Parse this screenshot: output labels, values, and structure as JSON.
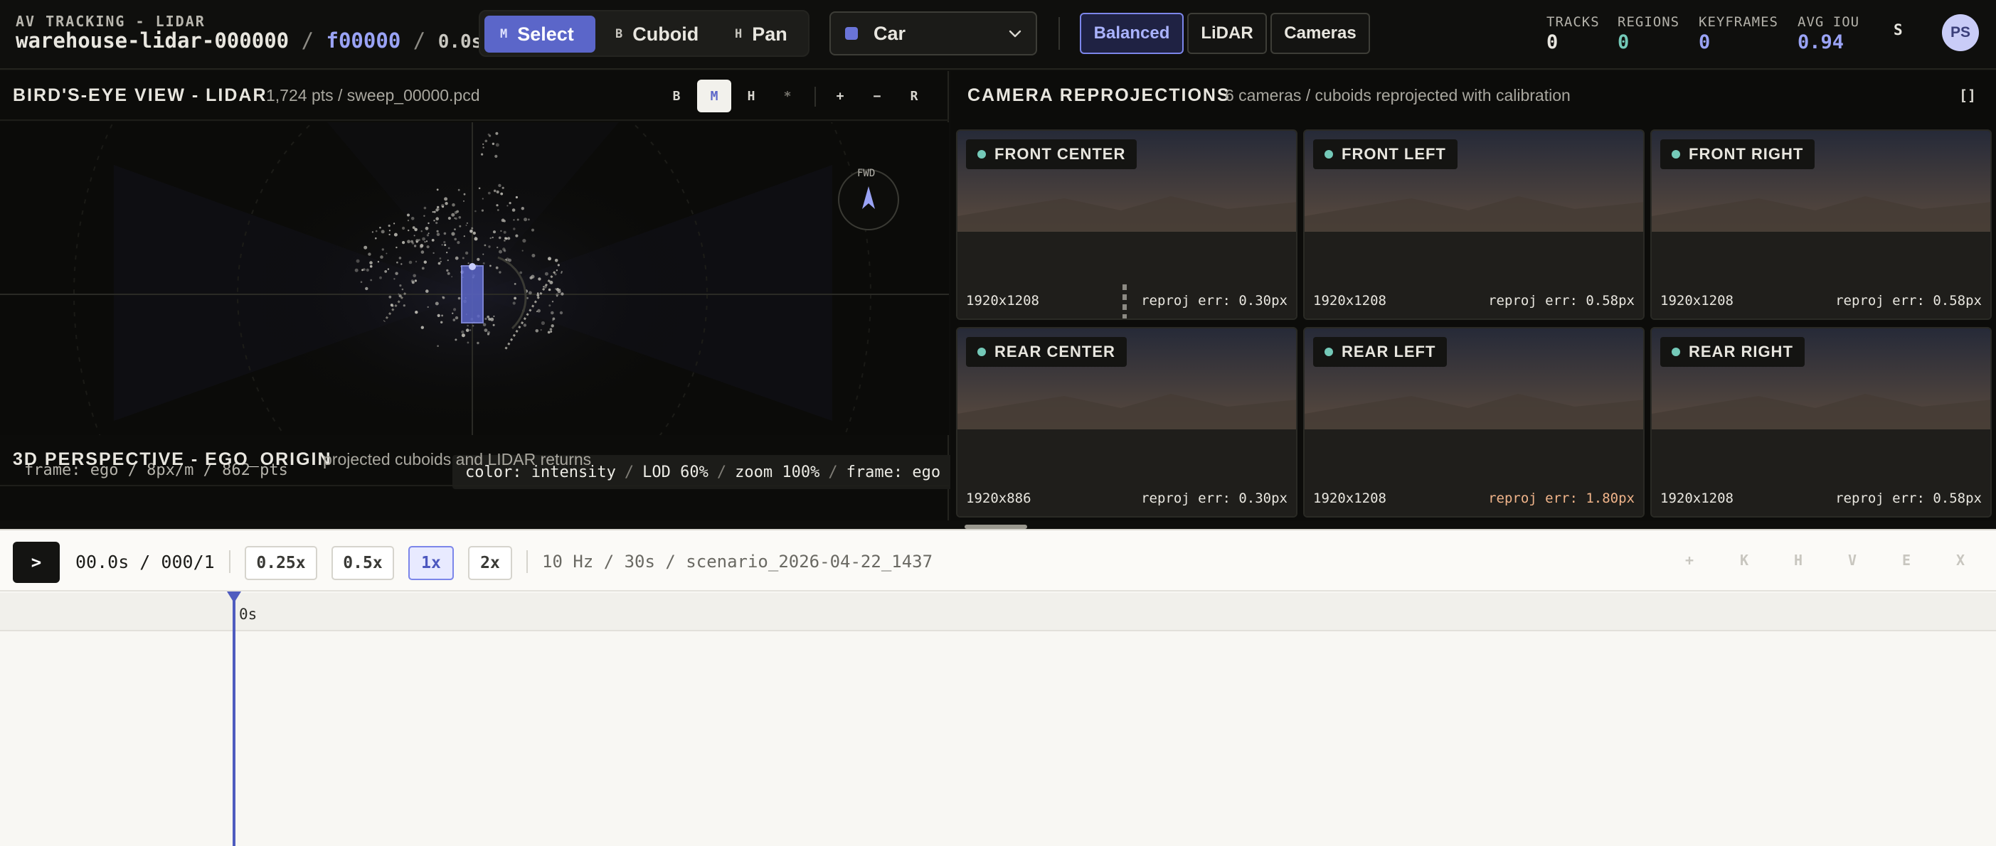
{
  "header": {
    "kicker": "AV TRACKING - LIDAR",
    "dataset": "warehouse-lidar-000000",
    "sep1": "/",
    "frame": "f00000",
    "sep2": "/",
    "time": "0.0s",
    "tools": [
      {
        "key": "M",
        "label": "Select",
        "active": true
      },
      {
        "key": "B",
        "label": "Cuboid",
        "active": false
      },
      {
        "key": "H",
        "label": "Pan",
        "active": false
      }
    ],
    "class_select": {
      "value": "Car",
      "color": "#6a74d8"
    },
    "presets": [
      {
        "label": "Balanced",
        "active": true
      },
      {
        "label": "LiDAR",
        "active": false
      },
      {
        "label": "Cameras",
        "active": false
      }
    ],
    "stats": [
      {
        "label": "TRACKS",
        "value": "0",
        "color": "#e8e6df"
      },
      {
        "label": "REGIONS",
        "value": "0",
        "color": "#74c9b8"
      },
      {
        "label": "KEYFRAMES",
        "value": "0",
        "color": "#9aa3f5"
      },
      {
        "label": "AVG IOU",
        "value": "0.94",
        "color": "#9aa3f5"
      }
    ],
    "shortcut": "S",
    "avatar": "PS"
  },
  "bev": {
    "title": "BIRD'S-EYE VIEW - LIDAR",
    "meta": "1,724 pts / sweep_00000.pcd",
    "view_buttons": [
      "B",
      "M",
      "H",
      "*"
    ],
    "zoom_buttons": [
      "+",
      "−",
      "R"
    ],
    "compass_label": "FWD",
    "footer_left": "frame: ego / 8px/m / 862 pts",
    "status": {
      "color": "color: intensity",
      "lod": "LOD 60%",
      "zoom": "zoom 100%",
      "frame": "frame: ego",
      "sep": "/"
    }
  },
  "perspective": {
    "title": "3D PERSPECTIVE - EGO_ORIGIN",
    "subtitle": "projected cuboids and LIDAR returns"
  },
  "cameras": {
    "title": "CAMERA REPROJECTIONS",
    "subtitle": "6 cameras / cuboids reprojected with calibration",
    "expand": "[]",
    "tiles": [
      {
        "name": "FRONT CENTER",
        "res": "1920x1208",
        "err": "reproj err: 0.30px",
        "warn": false
      },
      {
        "name": "FRONT LEFT",
        "res": "1920x1208",
        "err": "reproj err: 0.58px",
        "warn": false
      },
      {
        "name": "FRONT RIGHT",
        "res": "1920x1208",
        "err": "reproj err: 0.58px",
        "warn": false
      },
      {
        "name": "REAR CENTER",
        "res": "1920x886",
        "err": "reproj err: 0.30px",
        "warn": false
      },
      {
        "name": "REAR LEFT",
        "res": "1920x1208",
        "err": "reproj err: 1.80px",
        "warn": true
      },
      {
        "name": "REAR RIGHT",
        "res": "1920x1208",
        "err": "reproj err: 0.58px",
        "warn": false
      }
    ]
  },
  "timeline": {
    "play": ">",
    "time_readout": "00.0s / 000/1",
    "speeds": [
      {
        "label": "0.25x",
        "active": false
      },
      {
        "label": "0.5x",
        "active": false
      },
      {
        "label": "1x",
        "active": true
      },
      {
        "label": "2x",
        "active": false
      }
    ],
    "scenario": "10 Hz / 30s / scenario_2026-04-22_1437",
    "tools": [
      "+",
      "K",
      "H",
      "V",
      "E",
      "X"
    ],
    "ruler_label": "0s"
  }
}
